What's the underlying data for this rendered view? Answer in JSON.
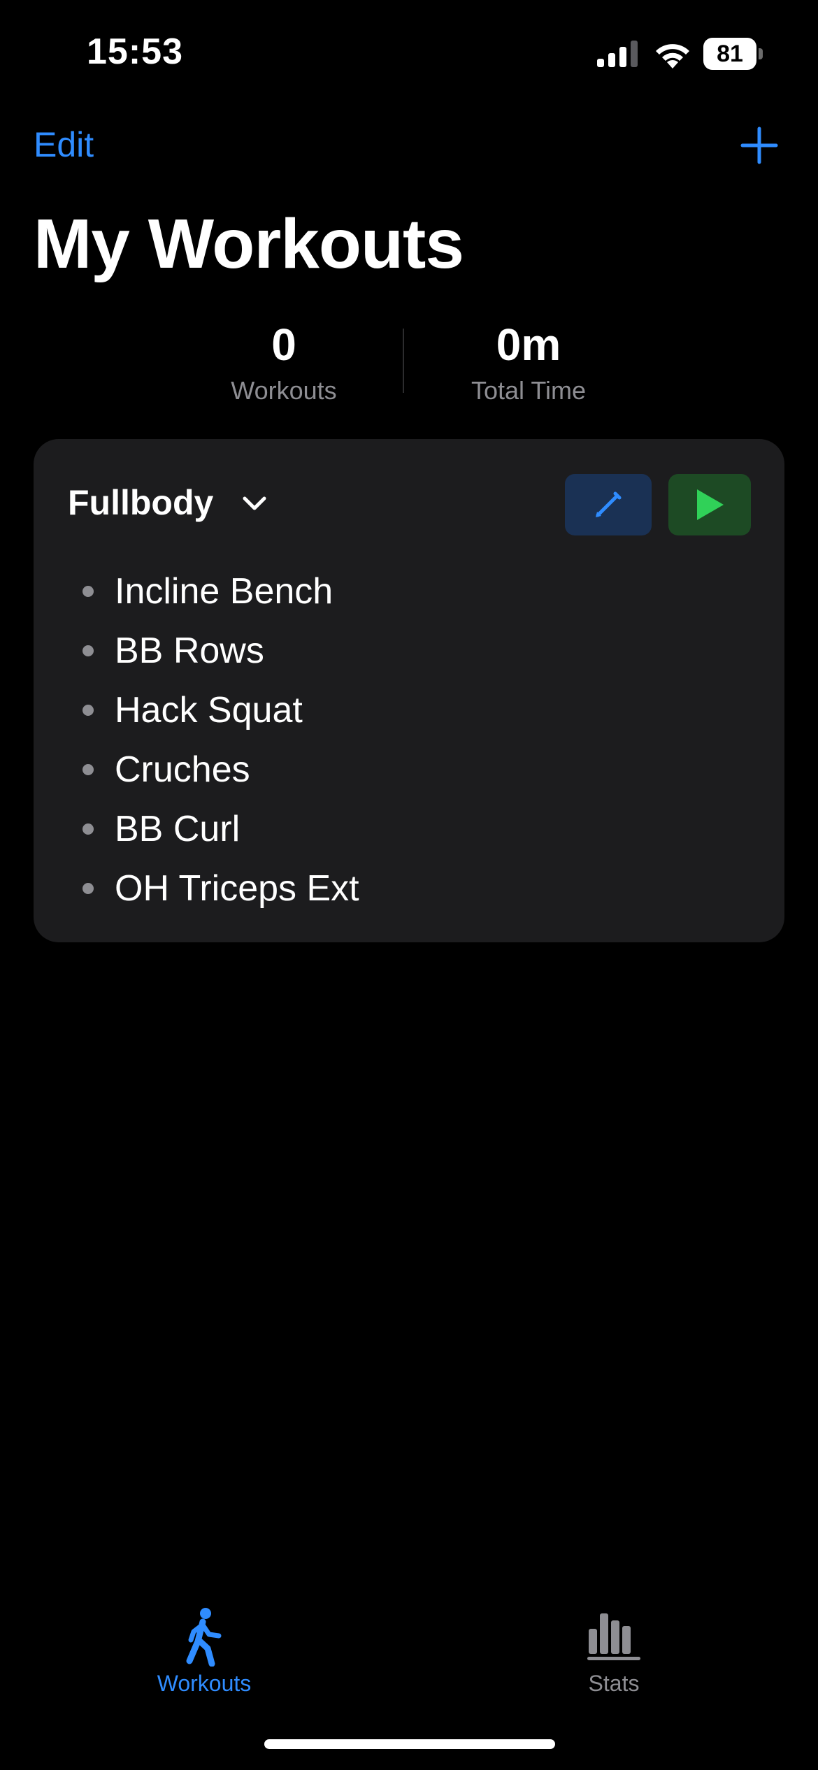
{
  "status_bar": {
    "time": "15:53",
    "battery_level": "81",
    "icons": [
      "signal-icon",
      "wifi-icon",
      "battery-icon"
    ]
  },
  "nav": {
    "edit_label": "Edit",
    "add_icon": "plus-icon"
  },
  "page": {
    "title": "My Workouts"
  },
  "summary": {
    "workouts_value": "0",
    "workouts_label": "Workouts",
    "total_time_value": "0m",
    "total_time_label": "Total Time"
  },
  "workout_card": {
    "title": "Fullbody",
    "exercises": [
      "Incline Bench",
      "BB Rows",
      "Hack Squat",
      "Cruches",
      "BB Curl",
      "OH Triceps Ext"
    ],
    "edit_icon": "pencil-icon",
    "start_icon": "play-icon"
  },
  "tab_bar": {
    "tabs": [
      {
        "label": "Workouts",
        "icon": "walking-figure-icon",
        "selected": true
      },
      {
        "label": "Stats",
        "icon": "bar-chart-icon",
        "selected": false
      }
    ]
  },
  "colors": {
    "accent": "#2f8cff",
    "start_green": "#30d158",
    "background": "#000000",
    "card": "#1c1c1e",
    "secondary_text": "#8e8e93"
  }
}
